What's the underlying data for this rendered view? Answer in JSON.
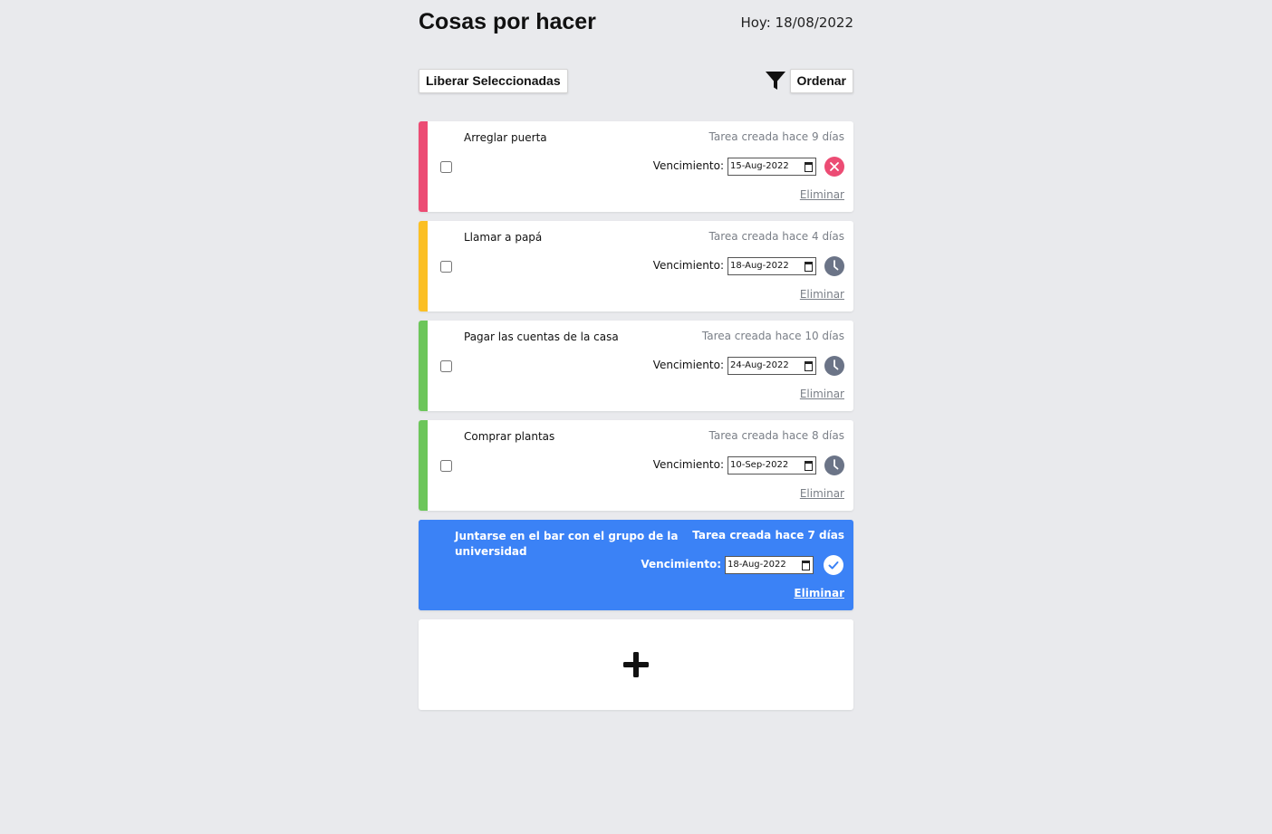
{
  "header": {
    "title": "Cosas por hacer",
    "today": "Hoy: 18/08/2022"
  },
  "toolbar": {
    "free_selected_label": "Liberar Seleccionadas",
    "filter_icon": "filter-icon",
    "sort_label": "Ordenar"
  },
  "tasks": [
    {
      "name": "Arreglar puerta",
      "created": "Tarea creada hace 9 días",
      "due_label": "Vencimiento:",
      "due_value": "15-Aug-2022",
      "status": "overdue",
      "status_icon": "x-circle-icon",
      "priority_color": "#ec4c74",
      "delete_label": "Eliminar",
      "checked": false,
      "selected": false
    },
    {
      "name": "Llamar a papá",
      "created": "Tarea creada hace 4 días",
      "due_label": "Vencimiento:",
      "due_value": "18-Aug-2022",
      "status": "pending",
      "status_icon": "clock-icon",
      "priority_color": "#fbbf24",
      "delete_label": "Eliminar",
      "checked": false,
      "selected": false
    },
    {
      "name": "Pagar las cuentas de la casa",
      "created": "Tarea creada hace 10 días",
      "due_label": "Vencimiento:",
      "due_value": "24-Aug-2022",
      "status": "pending",
      "status_icon": "clock-icon",
      "priority_color": "#6cc65a",
      "delete_label": "Eliminar",
      "checked": false,
      "selected": false
    },
    {
      "name": "Comprar plantas",
      "created": "Tarea creada hace 8 días",
      "due_label": "Vencimiento:",
      "due_value": "10-Sep-2022",
      "status": "pending",
      "status_icon": "clock-icon",
      "priority_color": "#6cc65a",
      "delete_label": "Eliminar",
      "checked": false,
      "selected": false
    },
    {
      "name": "Juntarse en el bar con el grupo de la universidad",
      "created": "Tarea creada hace 7 días",
      "due_label": "Vencimiento:",
      "due_value": "18-Aug-2022",
      "status": "done",
      "status_icon": "check-circle-icon",
      "priority_color": "#3b82f6",
      "delete_label": "Eliminar",
      "checked": true,
      "selected": true
    }
  ],
  "add_task": {
    "icon": "plus-icon"
  },
  "colors": {
    "background": "#e9eaed",
    "selected_card": "#3b82f6",
    "overdue": "#ec4c74",
    "pending": "#6b7487",
    "muted_text": "#7a7f87"
  }
}
